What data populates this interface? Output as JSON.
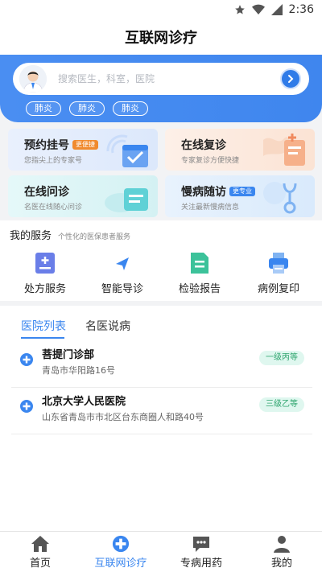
{
  "status": {
    "time": "2:36"
  },
  "appbar": {
    "title": "互联网诊疗"
  },
  "search": {
    "placeholder": "搜索医生，科室，医院"
  },
  "tags": [
    "肺炎",
    "肺炎",
    "肺炎"
  ],
  "cards": [
    {
      "title": "预约挂号",
      "badge": "更便捷",
      "sub": "您指尖上的专家号"
    },
    {
      "title": "在线复诊",
      "badge": "",
      "sub": "专家复诊方便快捷"
    },
    {
      "title": "在线问诊",
      "badge": "",
      "sub": "名医在线随心问诊"
    },
    {
      "title": "慢病随访",
      "badge": "更专业",
      "sub": "关注最新慢病信息"
    }
  ],
  "services": {
    "title": "我的服务",
    "subtitle": "个性化的医保患者服务",
    "items": [
      {
        "label": "处方服务",
        "icon": "prescription-icon"
      },
      {
        "label": "智能导诊",
        "icon": "navigation-icon"
      },
      {
        "label": "检验报告",
        "icon": "report-icon"
      },
      {
        "label": "病例复印",
        "icon": "printer-icon"
      }
    ]
  },
  "tabs": [
    {
      "label": "医院列表",
      "active": true
    },
    {
      "label": "名医说病",
      "active": false
    }
  ],
  "hospitals": [
    {
      "name": "菩提门诊部",
      "address": "青岛市华阳路16号",
      "level": "一级丙等"
    },
    {
      "name": "北京大学人民医院",
      "address": "山东省青岛市市北区台东商圈人和路40号",
      "level": "三级乙等"
    }
  ],
  "nav": [
    {
      "label": "首页",
      "icon": "home-icon"
    },
    {
      "label": "互联网诊疗",
      "icon": "medical-plus-icon",
      "active": true
    },
    {
      "label": "专病用药",
      "icon": "chat-icon"
    },
    {
      "label": "我的",
      "icon": "user-icon"
    }
  ],
  "colors": {
    "primary": "#3a86ef",
    "badge_orange": "#f08a2e",
    "badge_blue": "#3a86ef",
    "level_green": "#2fa56e"
  }
}
